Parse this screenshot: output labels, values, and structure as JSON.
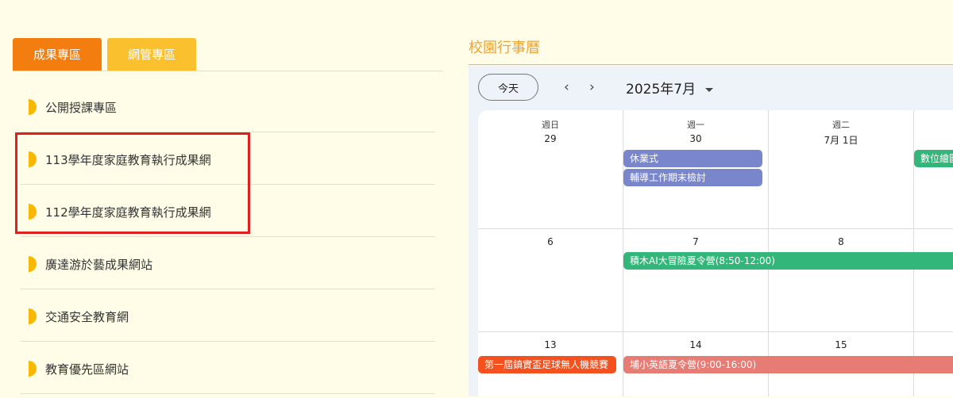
{
  "tabs": [
    "成果專區",
    "網管專區"
  ],
  "links": [
    "公開授課專區",
    "113學年度家庭教育執行成果網",
    "112學年度家庭教育執行成果網",
    "廣達游於藝成果網站",
    "交通安全教育網",
    "教育優先區網站"
  ],
  "calendar": {
    "title": "校園行事曆",
    "today": "今天",
    "prev": "‹",
    "next": "›",
    "month": "2025年7月",
    "dow": [
      "週日",
      "週一",
      "週二"
    ],
    "week1": [
      "29",
      "30",
      "7月 1日"
    ],
    "week2": [
      "6",
      "7",
      "8"
    ],
    "week3": [
      "13",
      "14",
      "15"
    ],
    "events": {
      "e1": "休業式",
      "e2": "輔導工作期末檢討",
      "e3": "數位繪圖",
      "e4": "積木AI大冒險夏令營(8:50-12:00)",
      "e5": "第一屆鎮實盃足球無人機競賽",
      "e6": "埔小英語夏令營(9:00-16:00)"
    },
    "colors": {
      "purple": "#7986cb",
      "green": "#33b679",
      "orange": "#f4511e",
      "salmon": "#e67c73"
    }
  }
}
